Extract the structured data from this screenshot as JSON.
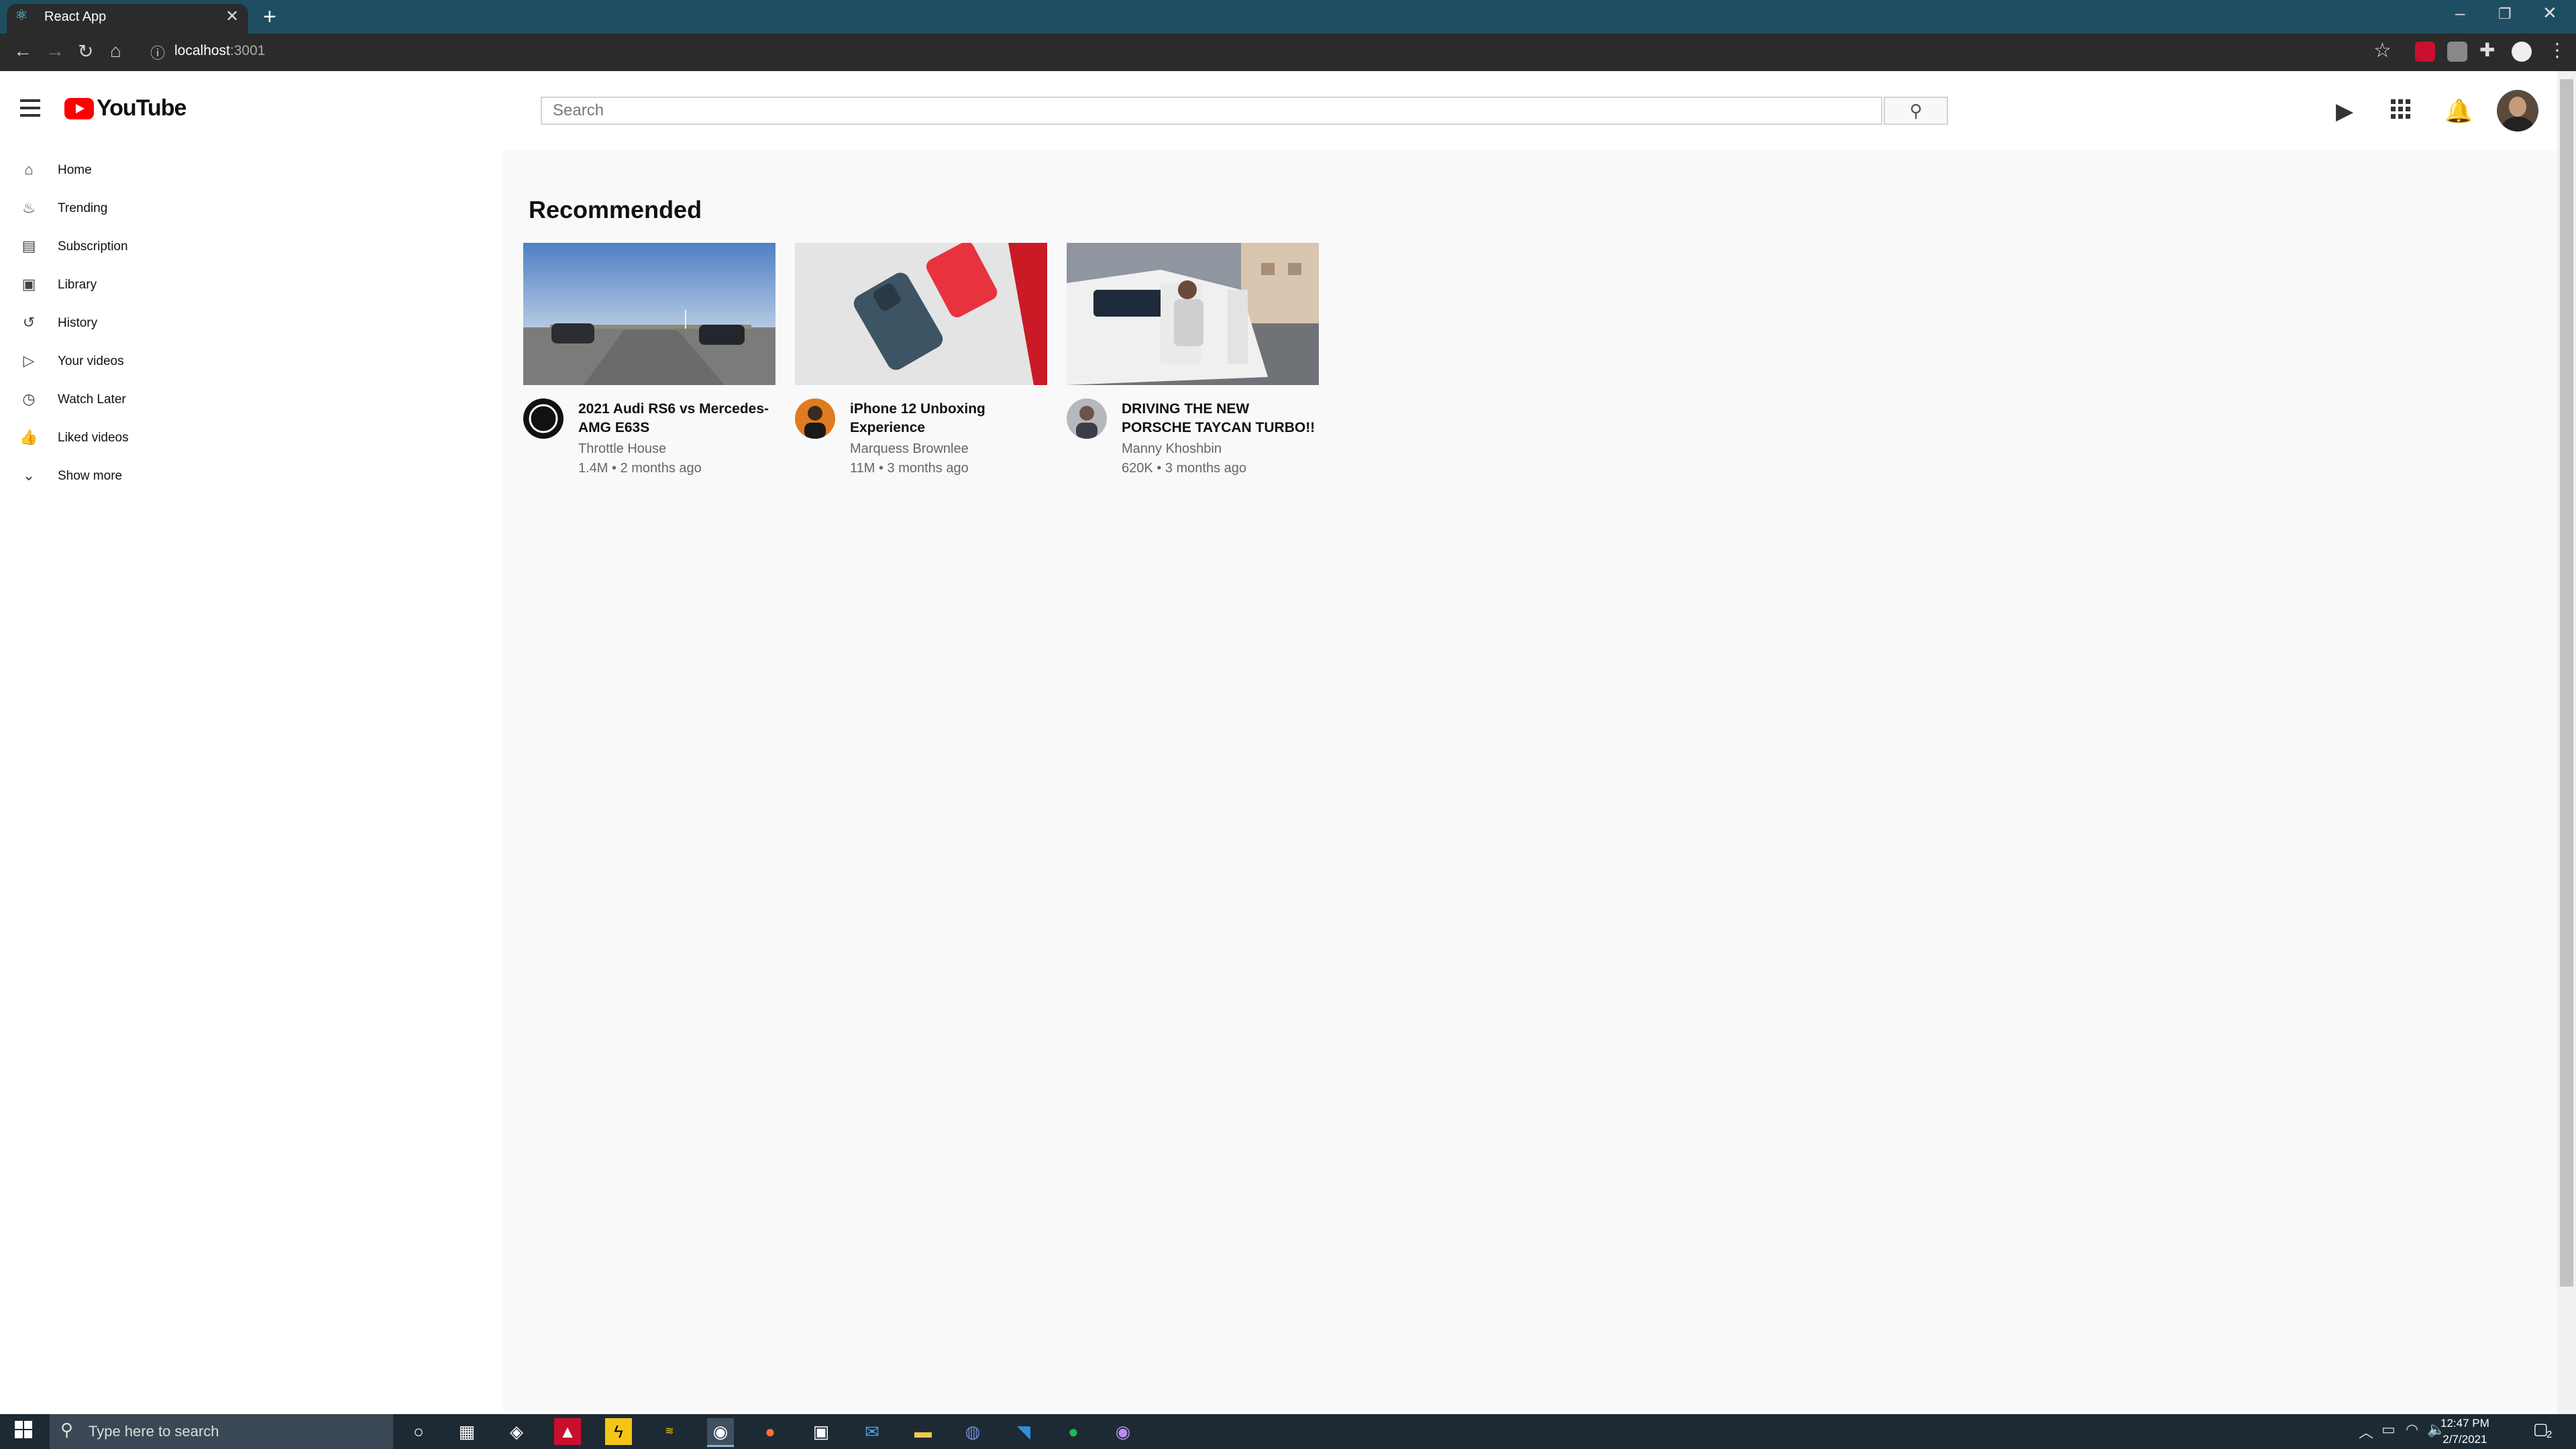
{
  "browser": {
    "tab_title": "React App",
    "new_tab": "+",
    "url_host": "localhost",
    "url_port": ":3001"
  },
  "header": {
    "logo_text": "YouTube",
    "search_placeholder": "Search"
  },
  "sidebar": {
    "items": [
      {
        "label": "Home",
        "icon": "home-icon"
      },
      {
        "label": "Trending",
        "icon": "fire-icon"
      },
      {
        "label": "Subscription",
        "icon": "subscriptions-icon"
      },
      {
        "label": "Library",
        "icon": "library-icon"
      },
      {
        "label": "History",
        "icon": "history-icon"
      },
      {
        "label": "Your videos",
        "icon": "video-icon"
      },
      {
        "label": "Watch Later",
        "icon": "clock-icon"
      },
      {
        "label": "Liked videos",
        "icon": "thumbs-up-icon"
      },
      {
        "label": "Show more",
        "icon": "chevron-down-icon"
      }
    ]
  },
  "main": {
    "section_title": "Recommended",
    "videos": [
      {
        "title": "2021 Audi RS6 vs Mercedes-AMG E63S",
        "channel": "Throttle House",
        "meta": "1.4M • 2 months ago"
      },
      {
        "title": "iPhone 12 Unboxing Experience",
        "channel": "Marquess Brownlee",
        "meta": "11M • 3 months ago"
      },
      {
        "title": "DRIVING THE NEW PORSCHE TAYCAN TURBO!!",
        "channel": "Manny Khoshbin",
        "meta": "620K • 3 months ago"
      }
    ]
  },
  "taskbar": {
    "search_placeholder": "Type here to search",
    "time": "12:47 PM",
    "date": "2/7/2021",
    "notification_count": "2"
  },
  "colors": {
    "youtube_red": "#ff0000",
    "titlebar": "#1f4e63",
    "taskbar": "#1e2a33"
  }
}
